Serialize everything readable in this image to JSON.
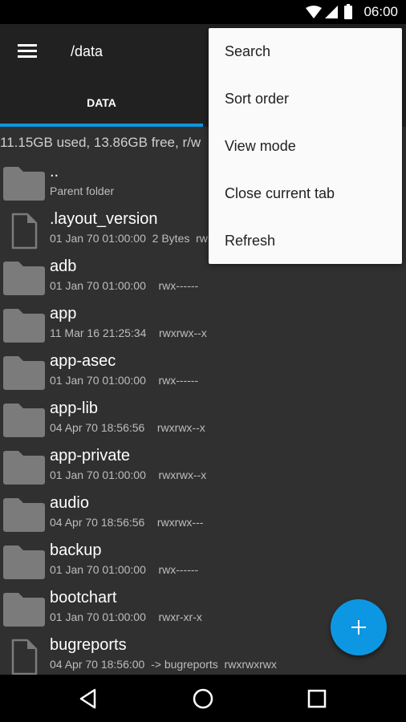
{
  "status_bar": {
    "time": "06:00",
    "icons": [
      "wifi-icon",
      "signal-icon",
      "battery-icon"
    ]
  },
  "app_bar": {
    "menu_icon": "hamburger-menu-icon",
    "path": "/data"
  },
  "tabs": [
    {
      "label": "DATA",
      "active": true
    }
  ],
  "storage_info": "11.15GB used, 13.86GB free, r/w",
  "files": [
    {
      "type": "folder",
      "name": "..",
      "meta": "Parent folder"
    },
    {
      "type": "file",
      "name": ".layout_version",
      "meta": "01 Jan 70 01:00:00  2 Bytes  rw"
    },
    {
      "type": "folder",
      "name": "adb",
      "meta": "01 Jan 70 01:00:00    rwx------"
    },
    {
      "type": "folder",
      "name": "app",
      "meta": "11 Mar 16 21:25:34    rwxrwx--x"
    },
    {
      "type": "folder",
      "name": "app-asec",
      "meta": "01 Jan 70 01:00:00    rwx------"
    },
    {
      "type": "folder",
      "name": "app-lib",
      "meta": "04 Apr 70 18:56:56    rwxrwx--x"
    },
    {
      "type": "folder",
      "name": "app-private",
      "meta": "01 Jan 70 01:00:00    rwxrwx--x"
    },
    {
      "type": "folder",
      "name": "audio",
      "meta": "04 Apr 70 18:56:56    rwxrwx---"
    },
    {
      "type": "folder",
      "name": "backup",
      "meta": "01 Jan 70 01:00:00    rwx------"
    },
    {
      "type": "folder",
      "name": "bootchart",
      "meta": "01 Jan 70 01:00:00    rwxr-xr-x"
    },
    {
      "type": "file",
      "name": "bugreports",
      "meta": "04 Apr 70 18:56:00  -> bugreports  rwxrwxrwx"
    }
  ],
  "menu": {
    "items": [
      {
        "label": "Search"
      },
      {
        "label": "Sort order"
      },
      {
        "label": "View mode"
      },
      {
        "label": "Close current tab"
      },
      {
        "label": "Refresh"
      }
    ]
  },
  "fab": {
    "icon": "plus-icon"
  },
  "nav_bar": {
    "buttons": [
      "back",
      "home",
      "recents"
    ]
  },
  "colors": {
    "accent": "#0d97e2",
    "app_bar": "#212121",
    "background": "#303030",
    "menu_bg": "#fafafa"
  }
}
